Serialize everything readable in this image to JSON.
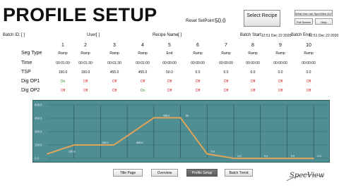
{
  "header": {
    "title": "PROFILE SETUP",
    "reset_label": "Reset SetPoint",
    "reset_value": "50.0",
    "select_recipe": "Select Recipe",
    "what_else": "What else can SpecView do?",
    "full_screen": "Full Screen",
    "help": "Help"
  },
  "info": {
    "batch_id_label": "Batch ID:",
    "batch_id_value": "[ ]",
    "user_label": "User:",
    "user_value": "[ ]",
    "recipe_label": "Recipe Name:",
    "recipe_value": "[ ]",
    "batch_start_label": "Batch Start:",
    "batch_start_value": "12:51 Dec 22 2020",
    "batch_end_label": "Batch End:",
    "batch_end_value": "12:51 Dec 22 2020"
  },
  "table": {
    "row_labels": [
      "Seg Type",
      "Time",
      "TSP",
      "Dig OP1",
      "Dig OP2"
    ],
    "segments": [
      {
        "num": "1",
        "type": "Ramp",
        "time": "00:01:00",
        "tsp": "150.0",
        "op1": "On",
        "op2": "Off"
      },
      {
        "num": "2",
        "type": "Ramp",
        "time": "00:01:30",
        "tsp": "150.0",
        "op1": "Off",
        "op2": "Off"
      },
      {
        "num": "3",
        "type": "Ramp",
        "time": "00:01:30",
        "tsp": "455.0",
        "op1": "Off",
        "op2": "Off"
      },
      {
        "num": "4",
        "type": "Ramp",
        "time": "00:01:00",
        "tsp": "455.0",
        "op1": "Off",
        "op2": "On"
      },
      {
        "num": "5",
        "type": "End",
        "time": "00:00:00",
        "tsp": "50.0",
        "op1": "Off",
        "op2": "Off"
      },
      {
        "num": "6",
        "type": "Ramp",
        "time": "00:00:00",
        "tsp": "0.0",
        "op1": "Off",
        "op2": "Off"
      },
      {
        "num": "7",
        "type": "Ramp",
        "time": "00:00:00",
        "tsp": "0.0",
        "op1": "Off",
        "op2": "Off"
      },
      {
        "num": "8",
        "type": "Ramp",
        "time": "00:00:00",
        "tsp": "0.0",
        "op1": "Off",
        "op2": "Off"
      },
      {
        "num": "9",
        "type": "Ramp",
        "time": "00:00:00",
        "tsp": "0.0",
        "op1": "Off",
        "op2": "Off"
      },
      {
        "num": "10",
        "type": "Ramp",
        "time": "00:00:00",
        "tsp": "0.0",
        "op1": "Off",
        "op2": "Off"
      }
    ]
  },
  "chart_data": {
    "type": "line",
    "ylim": [
      0,
      600
    ],
    "yticks": [
      "600.0",
      "450.0",
      "300.0",
      "150.0",
      "0.0"
    ],
    "x": [
      0,
      1,
      2.5,
      4,
      5,
      6,
      7,
      8,
      9,
      10
    ],
    "values": [
      50,
      150,
      150,
      455,
      455,
      50,
      0,
      0,
      0,
      0
    ],
    "point_labels": [
      "150.0",
      "150.0",
      "455.0",
      "455.0",
      "50",
      "0.0",
      "0.0",
      "0.0",
      "0.0",
      "0.0"
    ],
    "point_label_at": [
      0.95,
      2.2,
      3.5,
      4.5,
      5.35,
      6.3,
      7.3,
      8.3,
      9.3,
      10.3
    ],
    "grid": true,
    "colors": {
      "background": "#4f8f93",
      "line": "#e0a35a",
      "grid": "#2c5558"
    }
  },
  "nav": {
    "buttons": [
      "Title Page",
      "Overview",
      "Profile Setup",
      "Batch Trend"
    ],
    "active": "Profile Setup"
  },
  "logo": {
    "text": "SpecView"
  }
}
